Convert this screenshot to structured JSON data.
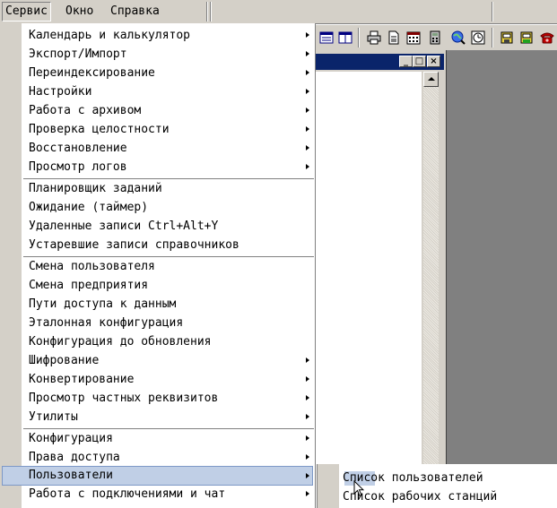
{
  "menubar": {
    "items": [
      {
        "label": "Сервис"
      },
      {
        "label": "Окно"
      },
      {
        "label": "Справка"
      }
    ]
  },
  "toolbar": {
    "icons": [
      "list-view-icon",
      "columns-icon",
      "print-icon",
      "document-icon",
      "calendar-icon",
      "calculator-icon",
      "globe-search-icon",
      "clock-icon",
      "folder-save-icon",
      "folder-open-icon",
      "phone-icon"
    ]
  },
  "child_window": {
    "caption_buttons": {
      "minimize": "_",
      "maximize": "□",
      "close": "×"
    }
  },
  "menu": {
    "groups": [
      {
        "items": [
          {
            "label": "Календарь и калькулятор",
            "submenu": true
          },
          {
            "label": "Экспорт/Импорт",
            "submenu": true
          },
          {
            "label": "Переиндексирование",
            "submenu": true
          },
          {
            "label": "Настройки",
            "submenu": true
          },
          {
            "label": "Работа с архивом",
            "submenu": true
          },
          {
            "label": "Проверка целостности",
            "submenu": true
          },
          {
            "label": "Восстановление",
            "submenu": true
          },
          {
            "label": "Просмотр логов",
            "submenu": true
          }
        ]
      },
      {
        "items": [
          {
            "label": "Планировщик заданий",
            "submenu": false
          },
          {
            "label": "Ожидание (таймер)",
            "submenu": false
          },
          {
            "label": "Удаленные записи Ctrl+Alt+Y",
            "submenu": false
          },
          {
            "label": "Устаревшие записи справочников",
            "submenu": false
          }
        ]
      },
      {
        "items": [
          {
            "label": "Смена пользователя",
            "submenu": false
          },
          {
            "label": "Смена предприятия",
            "submenu": false
          },
          {
            "label": "Пути доступа к данным",
            "submenu": false
          },
          {
            "label": "Эталонная конфигурация",
            "submenu": false
          },
          {
            "label": "Конфигурация до обновления",
            "submenu": false
          },
          {
            "label": "Шифрование",
            "submenu": true
          },
          {
            "label": "Конвертирование",
            "submenu": true
          },
          {
            "label": "Просмотр частных реквизитов",
            "submenu": true
          },
          {
            "label": "Утилиты",
            "submenu": true
          }
        ]
      },
      {
        "items": [
          {
            "label": "Конфигурация",
            "submenu": true
          },
          {
            "label": "Права доступа",
            "submenu": true
          },
          {
            "label": "Пользователи",
            "submenu": true,
            "highlighted": true
          },
          {
            "label": "Работа с подключениями и чат",
            "submenu": true
          }
        ]
      }
    ]
  },
  "submenu": {
    "items": [
      {
        "label": "Список пользователей"
      },
      {
        "label": "Список рабочих станций"
      }
    ]
  },
  "colors": {
    "face": "#d4d0c8",
    "menu_bg": "#ffffff",
    "highlight": "#c0cfe6",
    "highlight_border": "#7d98c6",
    "titlebar": "#0a246a",
    "workspace": "#808080"
  }
}
